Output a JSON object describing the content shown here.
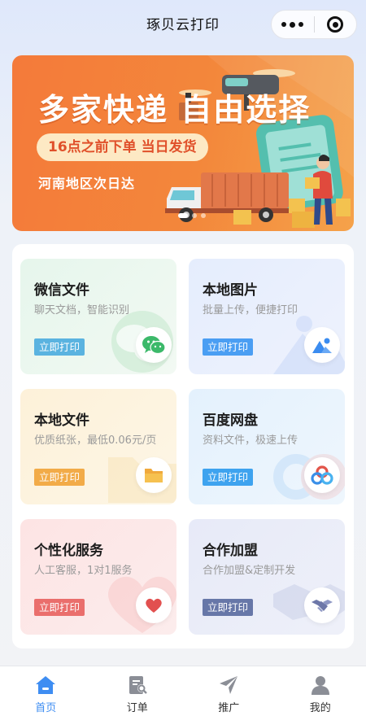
{
  "app": {
    "title": "琢贝云打印"
  },
  "banner": {
    "headline": "多家快递 自由选择",
    "pill": "16点之前下单 当日发货",
    "subtitle": "河南地区次日达"
  },
  "services": [
    {
      "title": "微信文件",
      "desc": "聊天文档，智能识别",
      "button": "立即打印",
      "icon": "wechat-icon",
      "accent": "#5ab3e0"
    },
    {
      "title": "本地图片",
      "desc": "批量上传，便捷打印",
      "button": "立即打印",
      "icon": "image-icon",
      "accent": "#4a9ef3"
    },
    {
      "title": "本地文件",
      "desc": "优质纸张，最低0.06元/页",
      "button": "立即打印",
      "icon": "folder-icon",
      "accent": "#f2ab48"
    },
    {
      "title": "百度网盘",
      "desc": "资料文件，极速上传",
      "button": "立即打印",
      "icon": "baidu-netdisk-icon",
      "accent": "#3ea3ef"
    },
    {
      "title": "个性化服务",
      "desc": "人工客服，1对1服务",
      "button": "立即打印",
      "icon": "heart-icon",
      "accent": "#ea6e6c"
    },
    {
      "title": "合作加盟",
      "desc": "合作加盟&定制开发",
      "button": "立即打印",
      "icon": "handshake-icon",
      "accent": "#6777a8"
    }
  ],
  "tabbar": [
    {
      "label": "首页",
      "icon": "home-icon",
      "active": true
    },
    {
      "label": "订单",
      "icon": "order-icon",
      "active": false
    },
    {
      "label": "推广",
      "icon": "send-icon",
      "active": false
    },
    {
      "label": "我的",
      "icon": "user-icon",
      "active": false
    }
  ],
  "colors": {
    "tab_active": "#3e8df2",
    "tab_inactive": "#8b8e96",
    "banner": "#f47a3a"
  }
}
